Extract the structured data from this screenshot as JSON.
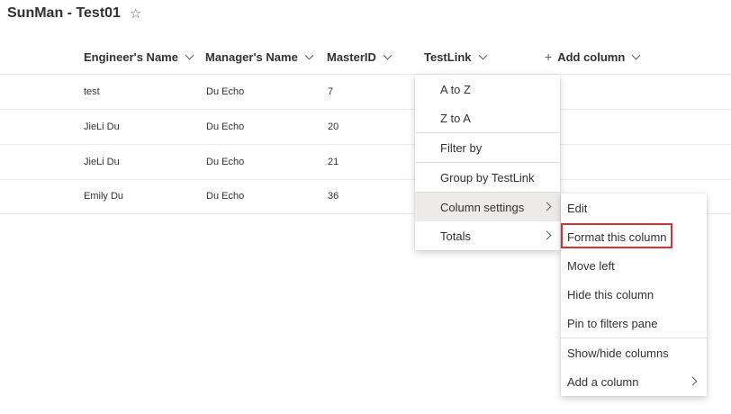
{
  "page": {
    "title": "SunMan - Test01",
    "favorite_icon": "star-icon"
  },
  "columns": [
    {
      "label": "Engineer's Name"
    },
    {
      "label": "Manager's Name"
    },
    {
      "label": "MasterID"
    },
    {
      "label": "TestLink"
    }
  ],
  "add_column": {
    "label": "Add column",
    "icon": "plus-icon"
  },
  "rows": [
    {
      "engineer": "test",
      "manager": "Du Echo",
      "master_id": "7"
    },
    {
      "engineer": "JieLi Du",
      "manager": "Du Echo",
      "master_id": "20"
    },
    {
      "engineer": "JieLi Du",
      "manager": "Du Echo",
      "master_id": "21"
    },
    {
      "engineer": "Emily Du",
      "manager": "Du Echo",
      "master_id": "36"
    }
  ],
  "column_menu": {
    "items": [
      {
        "label": "A to Z"
      },
      {
        "label": "Z to A"
      },
      {
        "label": "Filter by"
      },
      {
        "label": "Group by TestLink"
      },
      {
        "label": "Column settings",
        "has_submenu": true,
        "active": true
      },
      {
        "label": "Totals",
        "has_submenu": true
      }
    ]
  },
  "settings_submenu": {
    "items": [
      {
        "label": "Edit"
      },
      {
        "label": "Format this column",
        "highlighted": true,
        "highlight_color": "#d13438"
      },
      {
        "label": "Move left"
      },
      {
        "label": "Hide this column"
      },
      {
        "label": "Pin to filters pane"
      },
      {
        "label": "Show/hide columns"
      },
      {
        "label": "Add a column",
        "has_submenu": true
      }
    ]
  },
  "colors": {
    "text": "#323130",
    "divider": "#edebe9",
    "active_bg": "#edebe9",
    "highlight": "#d13438"
  }
}
